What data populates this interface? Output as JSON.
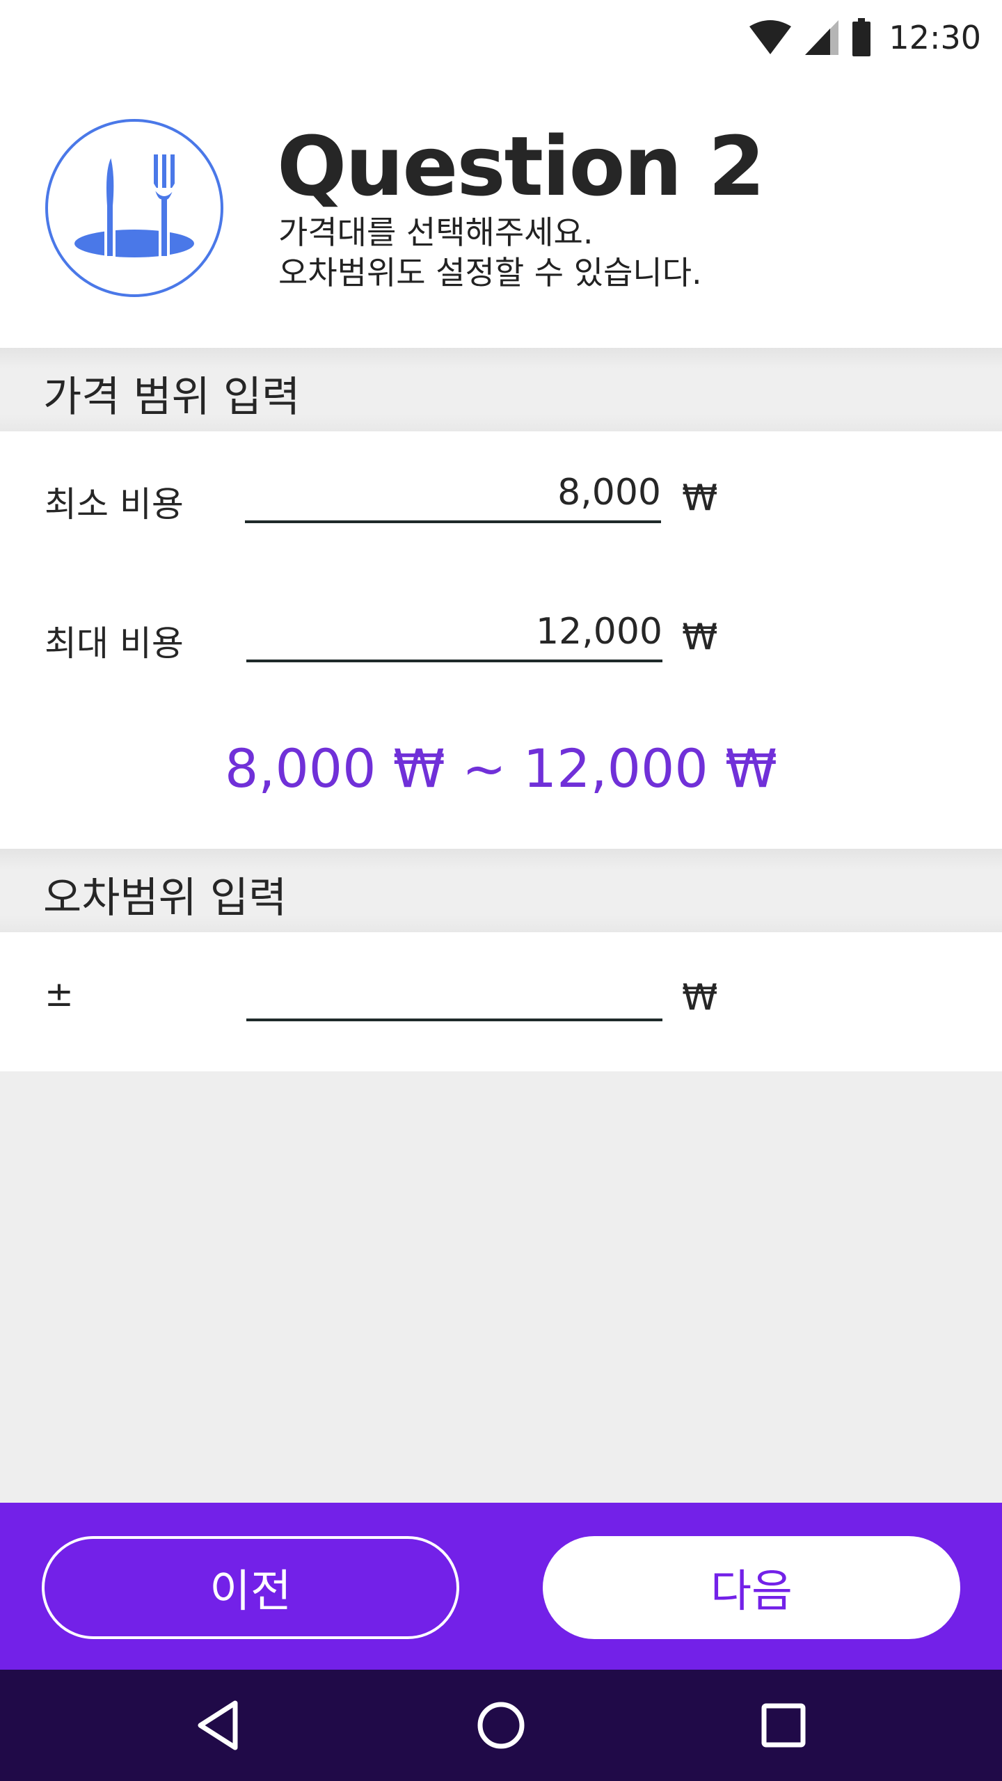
{
  "status_bar": {
    "time": "12:30",
    "icons": [
      "wifi-icon",
      "signal-icon",
      "battery-icon"
    ]
  },
  "header": {
    "icon": "restaurant-icon",
    "title": "Question 2",
    "description_line1": "가격대를 선택해주세요.",
    "description_line2": "오차범위도 설정할 수 있습니다."
  },
  "price_section": {
    "title": "가격 범위 입력",
    "min_label": "최소 비용",
    "min_value": "8,000",
    "max_label": "최대 비용",
    "max_value": "12,000",
    "currency": "₩",
    "summary": "8,000 ₩ ~ 12,000 ₩"
  },
  "tolerance_section": {
    "title": "오차범위 입력",
    "label": "±",
    "value": "",
    "currency": "₩"
  },
  "buttons": {
    "prev_label": "이전",
    "next_label": "다음"
  },
  "nav_bar": {
    "icons": [
      "back-icon",
      "home-icon",
      "recents-icon"
    ]
  },
  "colors": {
    "accent": "#7321e8",
    "summary_text": "#7030d8",
    "icon_blue": "#4a78e8",
    "nav_bg": "#200a48"
  }
}
